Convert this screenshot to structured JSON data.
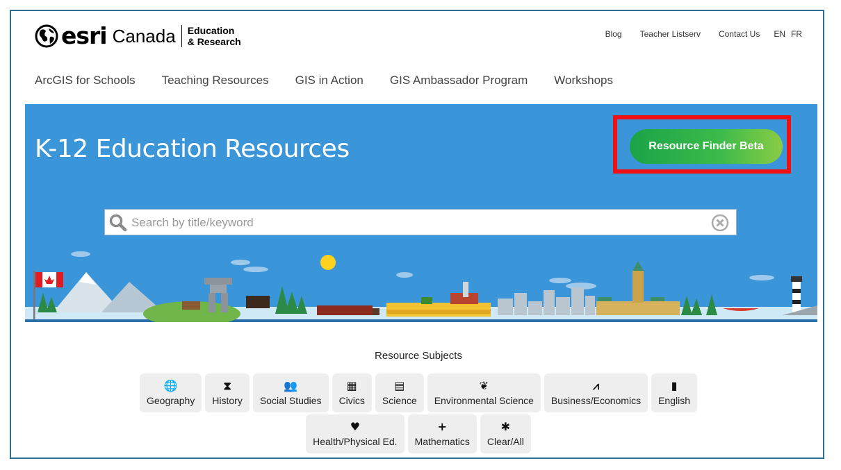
{
  "header": {
    "logo_brand": "esri",
    "logo_country": "Canada",
    "logo_unit_line1": "Education",
    "logo_unit_line2": "& Research",
    "top_links": [
      "Blog",
      "Teacher Listserv",
      "Contact Us"
    ],
    "languages": [
      "EN",
      "FR"
    ]
  },
  "nav": {
    "items": [
      "ArcGIS for Schools",
      "Teaching Resources",
      "GIS in Action",
      "GIS Ambassador Program",
      "Workshops"
    ]
  },
  "hero": {
    "title": "K-12 Education Resources",
    "resource_finder_label": "Resource Finder Beta",
    "search_placeholder": "Search by title/keyword",
    "background_color": "#3a96d9",
    "highlight_color": "#ee1111"
  },
  "subjects": {
    "title": "Resource Subjects",
    "row1": [
      {
        "label": "Geography",
        "icon": "globe-icon",
        "glyph": "🌐"
      },
      {
        "label": "History",
        "icon": "hourglass-icon",
        "glyph": "⧗"
      },
      {
        "label": "Social Studies",
        "icon": "users-icon",
        "glyph": "👥"
      },
      {
        "label": "Civics",
        "icon": "building-icon",
        "glyph": "▦"
      },
      {
        "label": "Science",
        "icon": "book-icon",
        "glyph": "▤"
      },
      {
        "label": "Environmental Science",
        "icon": "leaf-icon",
        "glyph": "❦"
      },
      {
        "label": "Business/Economics",
        "icon": "chart-icon",
        "glyph": "⩘"
      },
      {
        "label": "English",
        "icon": "file-icon",
        "glyph": "▮"
      }
    ],
    "row2": [
      {
        "label": "Health/Physical Ed.",
        "icon": "heartbeat-icon",
        "glyph": "♥"
      },
      {
        "label": "Mathematics",
        "icon": "plus-icon",
        "glyph": "+"
      },
      {
        "label": "Clear/All",
        "icon": "asterisk-icon",
        "glyph": "✱"
      }
    ]
  }
}
